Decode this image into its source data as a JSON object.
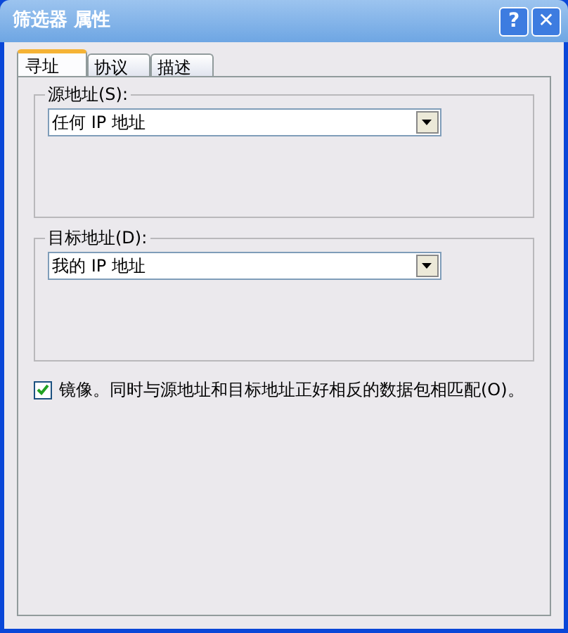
{
  "window": {
    "title": "筛选器 属性",
    "buttons": [
      "?",
      "✕"
    ]
  },
  "tabs": [
    {
      "label": "寻址",
      "selected": true
    },
    {
      "label": "协议",
      "selected": false
    },
    {
      "label": "描述",
      "selected": false
    }
  ],
  "groups": [
    {
      "label": "源地址(S):",
      "value": "任何 IP 地址"
    },
    {
      "label": "目标地址(D):",
      "value": "我的 IP 地址"
    }
  ],
  "mirror": {
    "label": "镜像。同时与源地址和目标地址正好相反的数据包相匹配(O)。",
    "checked": true
  }
}
